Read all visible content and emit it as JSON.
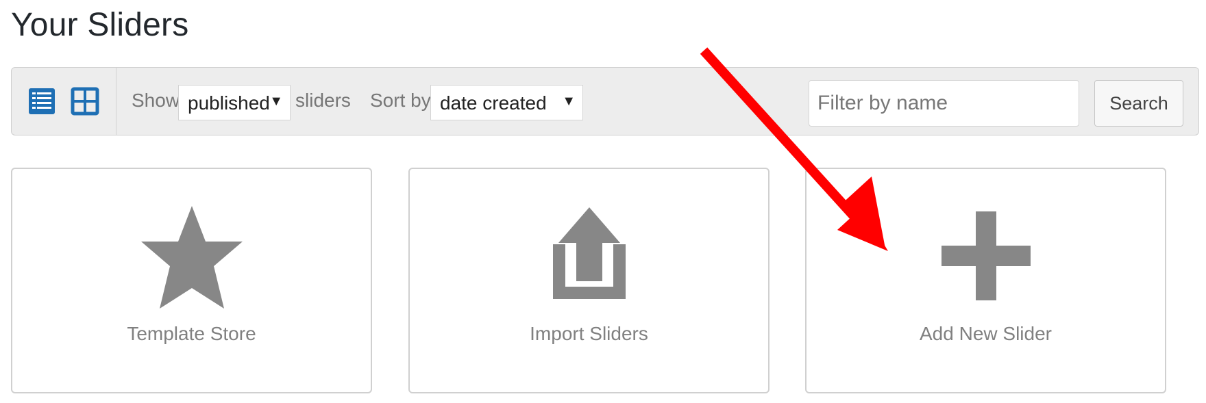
{
  "page": {
    "title": "Your Sliders"
  },
  "toolbar": {
    "show_label": "Show",
    "status_select": {
      "value": "published"
    },
    "after_status_label": "sliders",
    "sort_label": "Sort by",
    "sort_select": {
      "value": "date created"
    },
    "filter": {
      "placeholder": "Filter by name",
      "value": ""
    },
    "search_label": "Search",
    "view_icons": [
      "list-view-icon",
      "grid-view-icon"
    ]
  },
  "cards": [
    {
      "label": "Template Store",
      "icon": "star-icon"
    },
    {
      "label": "Import Sliders",
      "icon": "upload-icon"
    },
    {
      "label": "Add New Slider",
      "icon": "plus-icon"
    }
  ],
  "colors": {
    "view_icon_accent": "#1e6fb4",
    "card_icon": "#878787",
    "annotation_arrow": "#ff0000"
  }
}
